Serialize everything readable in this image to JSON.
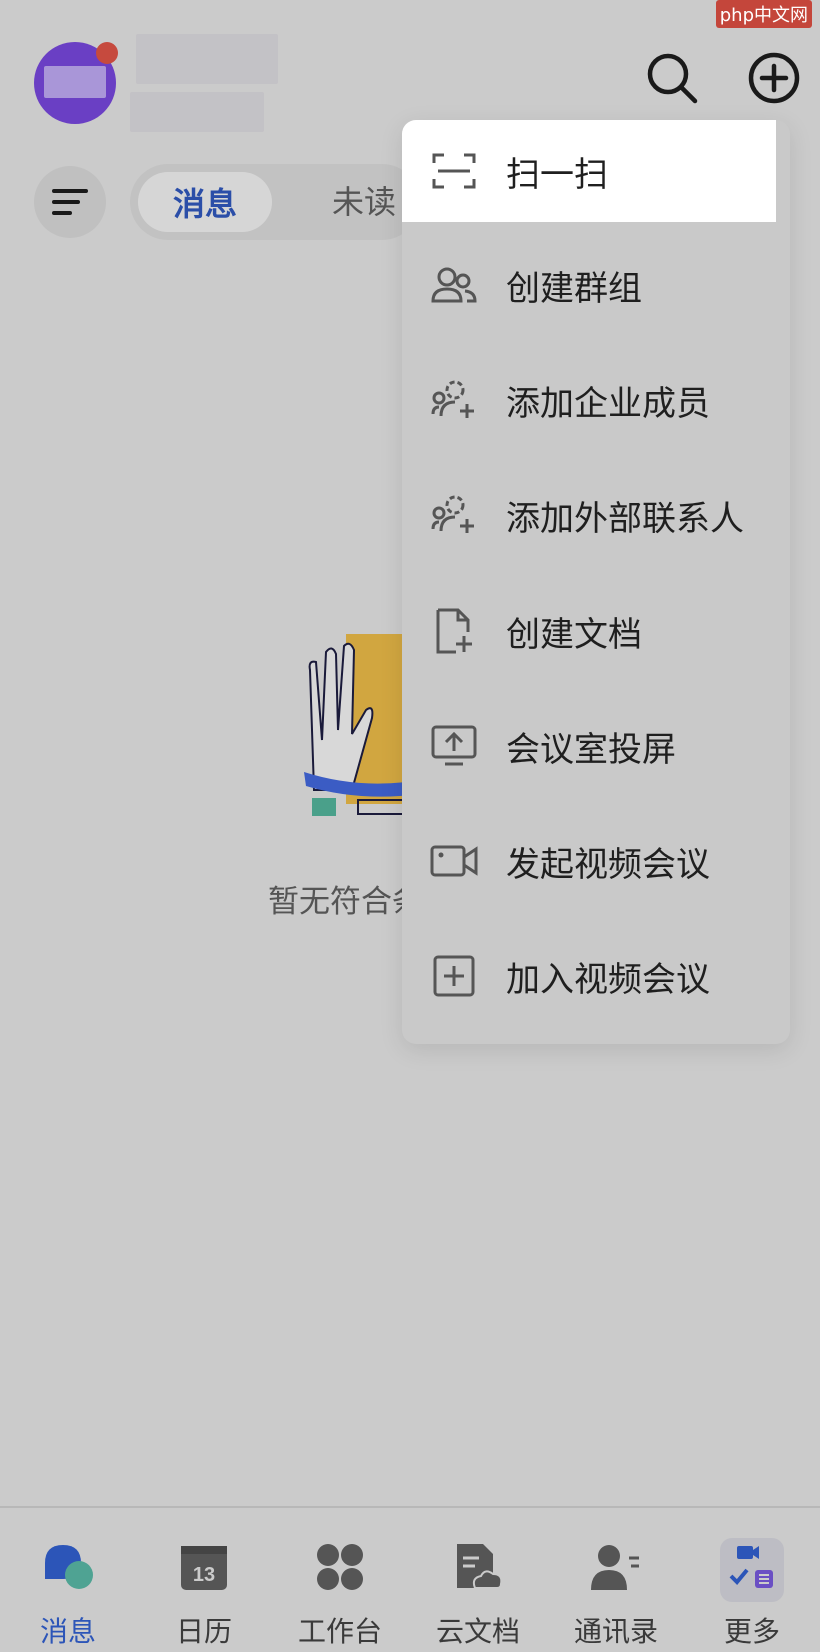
{
  "header": {
    "search_icon": "search-icon",
    "add_icon": "plus-circle-icon"
  },
  "filter": {
    "tabs": [
      {
        "label": "消息",
        "active": true
      },
      {
        "label": "未读",
        "active": false
      }
    ]
  },
  "empty_state": {
    "text": "暂无符合条件"
  },
  "dropdown": {
    "items": [
      {
        "label": "扫一扫",
        "icon": "scan-icon",
        "highlighted": true
      },
      {
        "label": "创建群组",
        "icon": "group-icon"
      },
      {
        "label": "添加企业成员",
        "icon": "add-member-icon"
      },
      {
        "label": "添加外部联系人",
        "icon": "add-contact-icon"
      },
      {
        "label": "创建文档",
        "icon": "new-doc-icon"
      },
      {
        "label": "会议室投屏",
        "icon": "screen-share-icon"
      },
      {
        "label": "发起视频会议",
        "icon": "video-icon"
      },
      {
        "label": "加入视频会议",
        "icon": "join-meeting-icon"
      }
    ]
  },
  "bottom_nav": {
    "items": [
      {
        "label": "消息",
        "icon": "chat-icon",
        "active": true
      },
      {
        "label": "日历",
        "icon": "calendar-icon",
        "badge": "13"
      },
      {
        "label": "工作台",
        "icon": "apps-icon"
      },
      {
        "label": "云文档",
        "icon": "cloud-doc-icon"
      },
      {
        "label": "通讯录",
        "icon": "contacts-icon"
      },
      {
        "label": "更多",
        "icon": "more-icon"
      }
    ]
  },
  "watermark": "php中文网",
  "colors": {
    "accent": "#2c55b8",
    "background": "#cbcbcb",
    "avatar": "#6a3fc4",
    "notification": "#c64a3e"
  }
}
